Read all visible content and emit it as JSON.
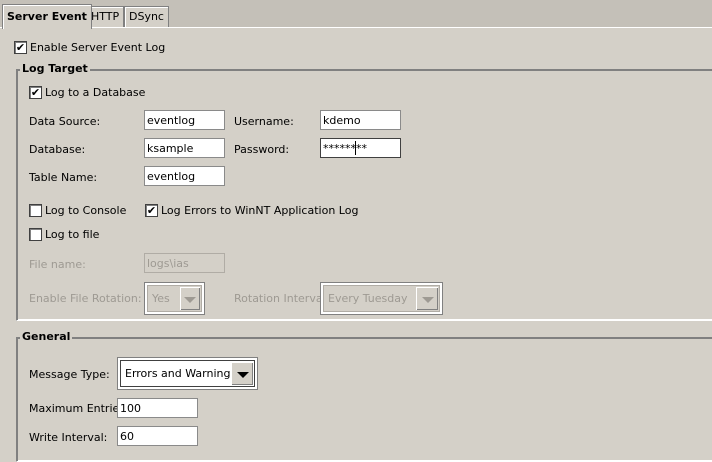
{
  "tabs": [
    {
      "label": "Server Event"
    },
    {
      "label": "HTTP"
    },
    {
      "label": "DSync"
    }
  ],
  "enable_log": {
    "label": "Enable Server Event Log",
    "checked": true
  },
  "log_target": {
    "title": "Log Target",
    "log_to_db": {
      "label": "Log to a Database",
      "checked": true
    },
    "data_source": {
      "label": "Data Source:",
      "value": "eventlog"
    },
    "username": {
      "label": "Username:",
      "value": "kdemo"
    },
    "database": {
      "label": "Database:",
      "value": "ksample"
    },
    "password": {
      "label": "Password:",
      "value": "********"
    },
    "table_name": {
      "label": "Table Name:",
      "value": "eventlog"
    },
    "log_console": {
      "label": "Log to Console",
      "checked": false
    },
    "log_winnt": {
      "label": "Log Errors to WinNT Application Log",
      "checked": true
    },
    "log_file": {
      "label": "Log to file",
      "checked": false
    },
    "file_name": {
      "label": "File name:",
      "value": "logs\\ias"
    },
    "file_rotation": {
      "label": "Enable File Rotation:",
      "value": "Yes"
    },
    "rotation_interval": {
      "label": "Rotation Interval:",
      "value": "Every Tuesday"
    }
  },
  "general": {
    "title": "General",
    "message_type": {
      "label": "Message Type:",
      "value": "Errors and Warnings"
    },
    "max_entries": {
      "label": "Maximum Entries:",
      "value": "100"
    },
    "write_interval": {
      "label": "Write Interval:",
      "value": "60"
    }
  },
  "check_glyph": "✔"
}
